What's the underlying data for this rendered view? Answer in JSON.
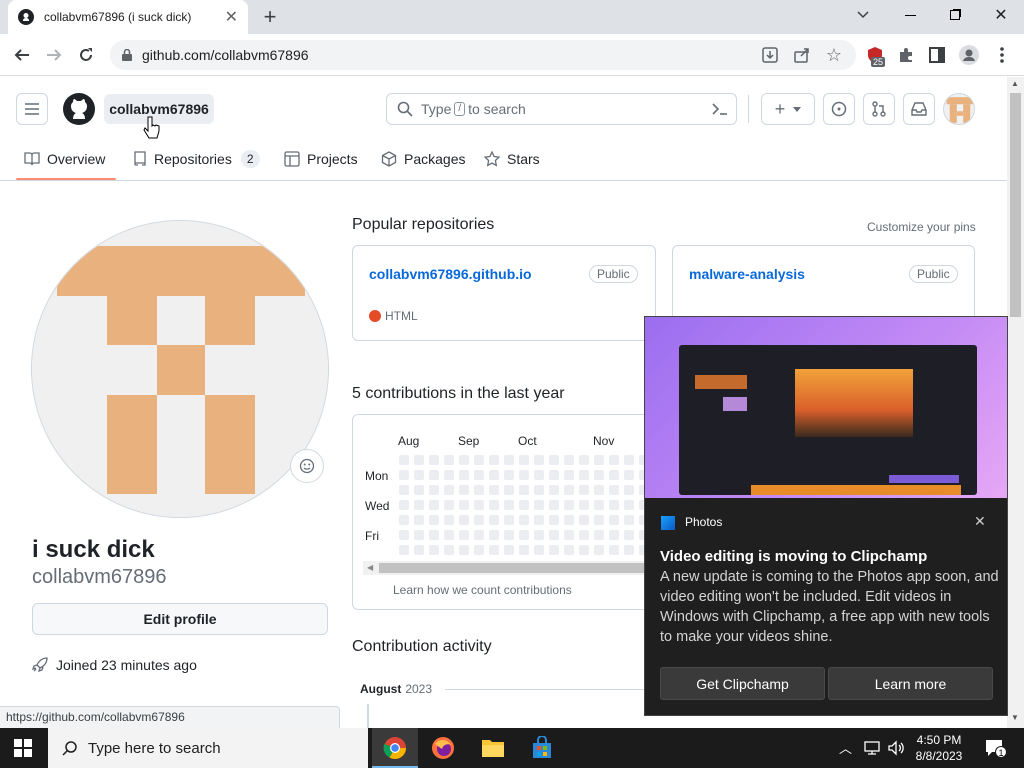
{
  "browser": {
    "tab_title": "collabvm67896 (i suck dick)",
    "url": "github.com/collabvm67896",
    "extension_badge": "25",
    "status_url": "https://github.com/collabvm67896"
  },
  "header": {
    "username": "collabvm67896",
    "search_prefix": "Type",
    "search_key": "/",
    "search_suffix": "to search"
  },
  "nav": {
    "overview": "Overview",
    "repositories": "Repositories",
    "repositories_count": "2",
    "projects": "Projects",
    "packages": "Packages",
    "stars": "Stars"
  },
  "profile": {
    "display_name": "i suck dick",
    "login": "collabvm67896",
    "edit_button": "Edit profile",
    "joined": "Joined 23 minutes ago"
  },
  "popular": {
    "heading": "Popular repositories",
    "customize": "Customize your pins",
    "repos": [
      {
        "name": "collabvm67896.github.io",
        "visibility": "Public",
        "language": "HTML",
        "lang_color": "#e34c26"
      },
      {
        "name": "malware-analysis",
        "visibility": "Public"
      }
    ]
  },
  "contributions": {
    "heading": "5 contributions in the last year",
    "months": [
      "Aug",
      "Sep",
      "Oct",
      "Nov"
    ],
    "days": [
      "Mon",
      "Wed",
      "Fri"
    ],
    "learn": "Learn how we count contributions"
  },
  "activity": {
    "heading": "Contribution activity",
    "month": "August",
    "year": "2023"
  },
  "toast": {
    "app": "Photos",
    "title": "Video editing is moving to Clipchamp",
    "body": "A new update is coming to the Photos app soon, and video editing won't be included. Edit videos in Windows with Clipchamp, a free app with new tools to make your videos shine.",
    "primary": "Get Clipchamp",
    "secondary": "Learn more"
  },
  "taskbar": {
    "search_placeholder": "Type here to search",
    "time": "4:50 PM",
    "date": "8/8/2023",
    "notification_count": "1"
  },
  "colors": {
    "accent_orange": "#fd8c73",
    "link": "#0969da",
    "avatar_tan": "#e8b17e"
  }
}
